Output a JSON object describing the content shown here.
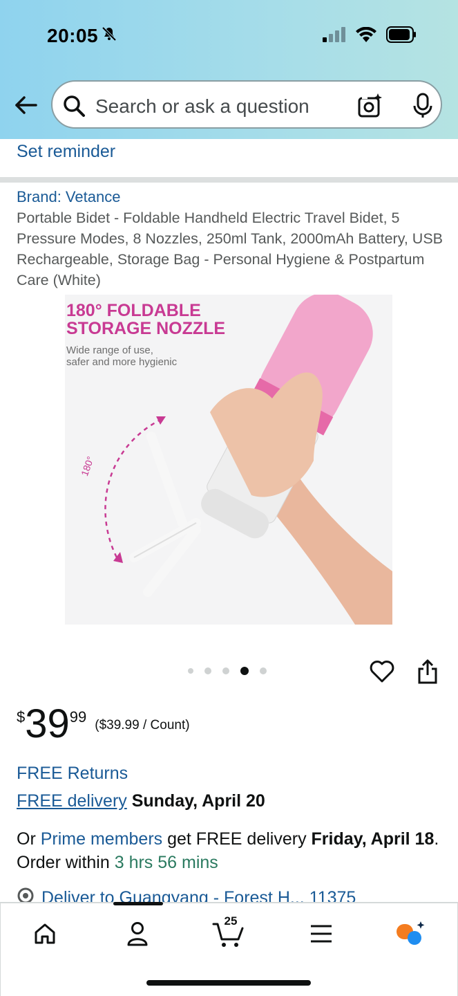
{
  "status_bar": {
    "time": "20:05"
  },
  "search": {
    "placeholder": "Search or ask a question"
  },
  "reminder": {
    "label": "Set reminder"
  },
  "product": {
    "brand": "Brand: Vetance",
    "title": "Portable Bidet - Foldable Handheld Electric Travel Bidet, 5 Pressure Modes, 8 Nozzles, 250ml Tank, 2000mAh Battery, USB Rechargeable, Storage Bag - Personal Hygiene & Postpartum Care (White)",
    "image": {
      "headline_line1": "180° FOLDABLE",
      "headline_line2": "STORAGE NOZZLE",
      "sub_line1": "Wide range of use,",
      "sub_line2": "safer and more hygienic",
      "angle_label": "180°"
    },
    "carousel": {
      "count": 5,
      "active_index": 3
    }
  },
  "price": {
    "symbol": "$",
    "whole": "39",
    "fraction": "99",
    "unit_price": "($39.99 / Count)"
  },
  "delivery": {
    "free_returns": "FREE Returns",
    "free_delivery_link": "FREE delivery",
    "free_delivery_date": "Sunday, April 20",
    "prime_prefix": "Or",
    "prime_link": "Prime members",
    "prime_middle": "get FREE delivery",
    "prime_date": "Friday, April 18",
    "order_within_prefix": ". Order within",
    "order_within_time": "3 hrs 56 mins",
    "deliver_to": "Deliver to Guangyang - Forest H... 11375"
  },
  "bottom_nav": {
    "cart_count": "25",
    "items": [
      "home-icon",
      "profile-icon",
      "cart-icon",
      "menu-icon",
      "rufus-icon"
    ]
  },
  "colors": {
    "link_blue": "#1a5a96",
    "green": "#2a7a5f",
    "brand_pink": "#c83a93",
    "rufus_orange": "#f47c1f",
    "rufus_blue": "#1f8df0"
  }
}
